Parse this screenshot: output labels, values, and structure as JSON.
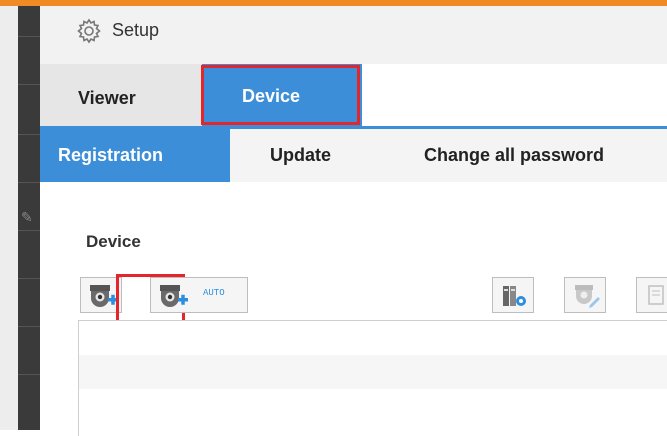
{
  "setup": {
    "title": "Setup",
    "icon": "gear-icon"
  },
  "main_tabs": [
    {
      "label": "Viewer"
    },
    {
      "label": "Device",
      "selected": true
    }
  ],
  "sub_tabs": [
    {
      "label": "Registration",
      "selected": true
    },
    {
      "label": "Update"
    },
    {
      "label": "Change all password"
    }
  ],
  "device": {
    "section_label": "Device",
    "toolbar": {
      "add_icon": "camera-add-icon",
      "auto_add_icon": "camera-auto-add-icon",
      "auto_label": "AUTO",
      "settings_icon": "device-settings-icon",
      "edit_icon": "camera-edit-icon"
    }
  },
  "colors": {
    "accent": "#f08a24",
    "tab_active": "#3d8ed8",
    "highlight": "#e2262b",
    "icon_blue": "#2d8ee0"
  }
}
